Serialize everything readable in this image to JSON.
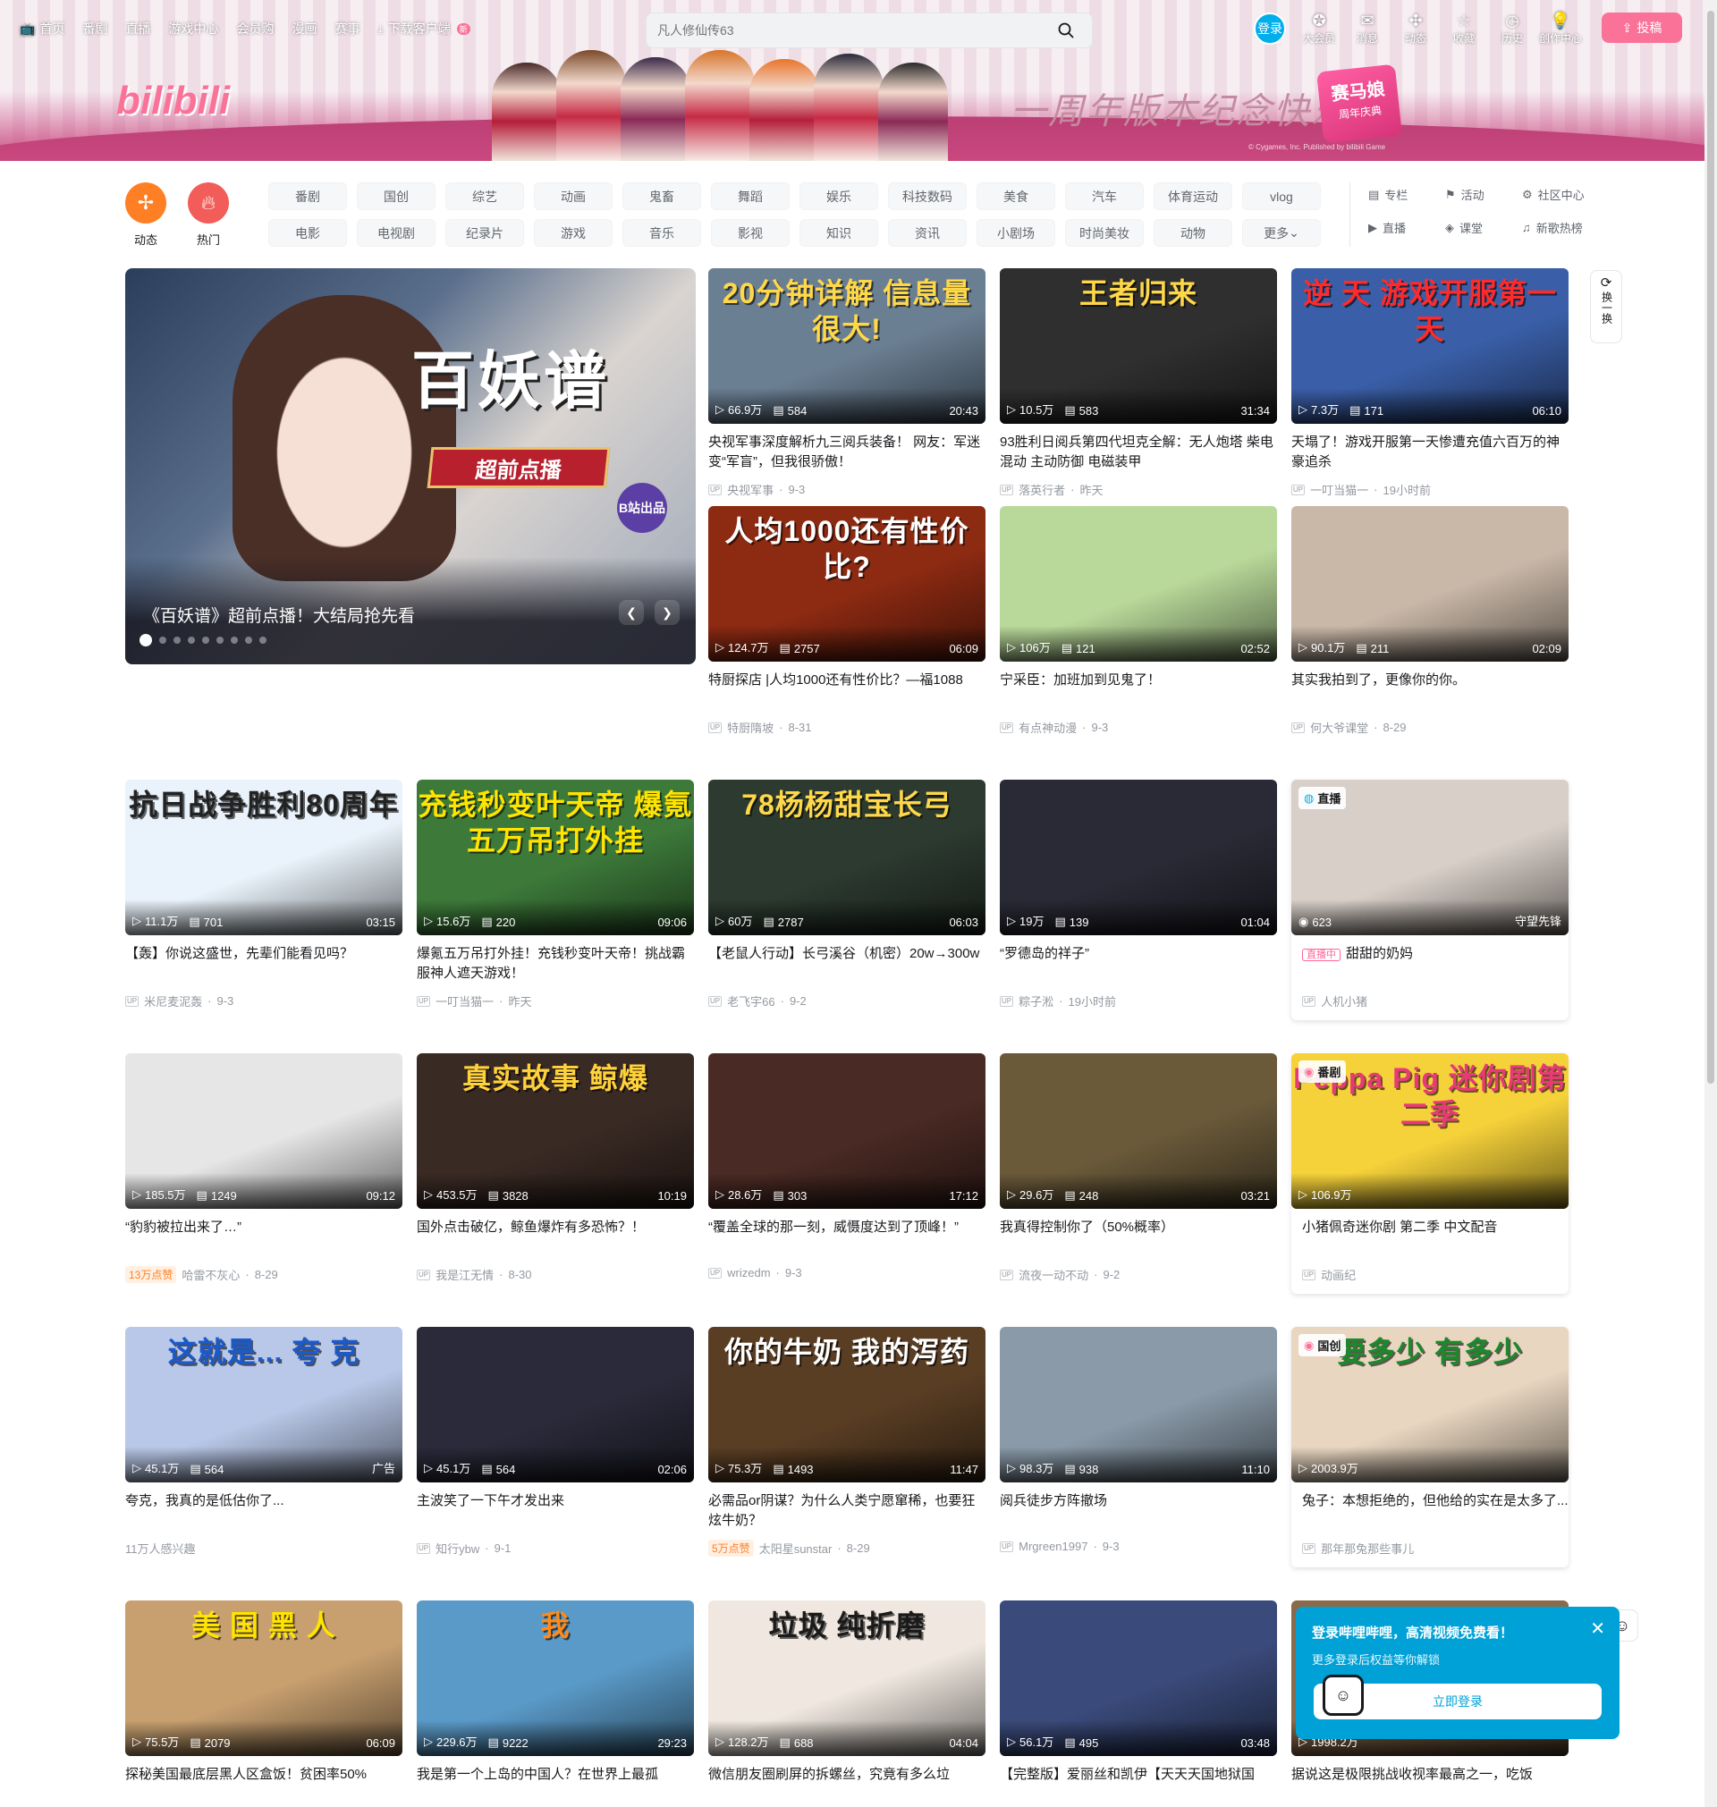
{
  "nav": {
    "items": [
      "首页",
      "番剧",
      "直播",
      "游戏中心",
      "会员购",
      "漫画",
      "赛事"
    ],
    "download": "下载客户端",
    "new_badge": "新"
  },
  "search": {
    "placeholder": "凡人修仙传63"
  },
  "login": "登录",
  "right_nav": [
    {
      "label": "大会员",
      "icon": "vip-icon"
    },
    {
      "label": "消息",
      "icon": "message-icon"
    },
    {
      "label": "动态",
      "icon": "dynamic-icon"
    },
    {
      "label": "收藏",
      "icon": "favorite-icon"
    },
    {
      "label": "历史",
      "icon": "history-icon"
    },
    {
      "label": "创作中心",
      "icon": "creator-icon"
    }
  ],
  "upload": "投稿",
  "banner": {
    "slogan": "一周年版本纪念快乐!",
    "logo": "bilibili",
    "game_badge": "赛马娘",
    "game_badge_sub": "周年庆典",
    "copyright": "© Cygames, Inc. Published by bilibili Game"
  },
  "channels": {
    "main": [
      {
        "label": "动态",
        "color": "#ff7f24",
        "icon": "wind-icon"
      },
      {
        "label": "热门",
        "color": "#f25d59",
        "icon": "fire-icon"
      }
    ],
    "chips": [
      "番剧",
      "国创",
      "综艺",
      "动画",
      "鬼畜",
      "舞蹈",
      "娱乐",
      "科技数码",
      "美食",
      "汽车",
      "体育运动",
      "vlog",
      "电影",
      "电视剧",
      "纪录片",
      "游戏",
      "音乐",
      "影视",
      "知识",
      "资讯",
      "小剧场",
      "时尚美妆",
      "动物",
      "更多"
    ],
    "side": [
      {
        "label": "专栏",
        "icon": "column-icon"
      },
      {
        "label": "活动",
        "icon": "activity-icon"
      },
      {
        "label": "社区中心",
        "icon": "community-icon"
      },
      {
        "label": "直播",
        "icon": "live-icon"
      },
      {
        "label": "课堂",
        "icon": "classroom-icon"
      },
      {
        "label": "新歌热榜",
        "icon": "music-chart-icon"
      }
    ]
  },
  "carousel": {
    "title": "《百妖谱》超前点播！大结局抢先看",
    "art_title": "百妖谱",
    "ribbon": "超前点播",
    "stamp": "B站出品",
    "dots": 9,
    "active_dot": 0
  },
  "refresh": {
    "label": "换一换"
  },
  "popup": {
    "title": "登录哔哩哔哩，高清视频免费看！",
    "subtitle": "更多登录后权益等你解锁",
    "button": "立即登录"
  },
  "cards": [
    {
      "art": "20分钟详解 信息量很大!",
      "views": "66.9万",
      "danmaku": "584",
      "duration": "20:43",
      "title": "央视军事深度解析九三阅兵装备！ 网友：军迷变“军盲”，但我很骄傲！",
      "author": "央视军事",
      "date": "9-3",
      "bg": "#6b7f93",
      "fg": "#ffd84a"
    },
    {
      "art": "王者归来",
      "views": "10.5万",
      "danmaku": "583",
      "duration": "31:34",
      "title": "93胜利日阅兵第四代坦克全解：无人炮塔 柴电混动 主动防御 电磁装甲",
      "author": "落英行者",
      "date": "昨天",
      "bg": "#2f2f2f",
      "fg": "#ffd84a"
    },
    {
      "art": "逆 天 游戏开服第一天",
      "views": "7.3万",
      "danmaku": "171",
      "duration": "06:10",
      "title": "天塌了！游戏开服第一天惨遭充值六百万的神豪追杀",
      "author": "一叮当猫一",
      "date": "19小时前",
      "bg": "#3a5fa8",
      "fg": "#ff2a2a"
    },
    {
      "art": "人均1000还有性价比?",
      "views": "124.7万",
      "danmaku": "2757",
      "duration": "06:09",
      "title": "特厨探店 |人均1000还有性价比？—福1088",
      "author": "特厨隋坡",
      "date": "8-31",
      "bg": "#8c2a12",
      "fg": "#ffffff"
    },
    {
      "art": "",
      "views": "106万",
      "danmaku": "121",
      "duration": "02:52",
      "title": "宁采臣：加班加到见鬼了！",
      "author": "有点神动漫",
      "date": "9-3",
      "bg": "#b9d99a",
      "fg": "#ffffff"
    },
    {
      "art": "",
      "views": "90.1万",
      "danmaku": "211",
      "duration": "02:09",
      "title": "其实我拍到了，更像你的你。",
      "author": "何大爷课堂",
      "date": "8-29",
      "bg": "#c9b8a8",
      "fg": "#ffffff"
    },
    {
      "art": "抗日战争胜利80周年",
      "views": "11.1万",
      "danmaku": "701",
      "duration": "03:15",
      "title": "【轰】你说这盛世，先辈们能看见吗？",
      "author": "米尼麦泥轰",
      "date": "9-3",
      "bg": "#eaf3fb",
      "fg": "#222222"
    },
    {
      "art": "充钱秒变叶天帝 爆氪五万吊打外挂",
      "views": "15.6万",
      "danmaku": "220",
      "duration": "09:06",
      "title": "爆氪五万吊打外挂！充钱秒变叶天帝！挑战霸服神人遮天游戏！",
      "author": "一叮当猫一",
      "date": "昨天",
      "bg": "#3d7a3a",
      "fg": "#ffe400"
    },
    {
      "art": "78杨杨甜宝长弓",
      "views": "60万",
      "danmaku": "2787",
      "duration": "06:03",
      "title": "【老鼠人行动】长弓溪谷（机密）20w→300w",
      "author": "老飞宇66",
      "date": "9-2",
      "bg": "#2c3a30",
      "fg": "#ffd84a"
    },
    {
      "art": "",
      "views": "19万",
      "danmaku": "139",
      "duration": "01:04",
      "title": "“罗德岛的祥子”",
      "author": "粽子淞",
      "date": "19小时前",
      "bg": "#2a2a36",
      "fg": "#ffffff"
    },
    {
      "art": "",
      "views": "623",
      "danmaku": "",
      "duration": "",
      "live_label": "直播",
      "streamer": "守望先锋",
      "title": "甜甜的奶妈",
      "live_badge": "直播中",
      "author": "人机小猪",
      "date": "",
      "bg": "#d8cfc8",
      "fg": "#ffffff"
    },
    {
      "art": "",
      "views": "185.5万",
      "danmaku": "1249",
      "duration": "09:12",
      "title": "“豹豹被拉出来了…”",
      "author": "哈雷不灰心",
      "date": "8-29",
      "hot": "13万点赞",
      "bg": "#e6e6e6",
      "fg": "#333333"
    },
    {
      "art": "真实故事 鲸爆",
      "views": "453.5万",
      "danmaku": "3828",
      "duration": "10:19",
      "title": "国外点击破亿，鲸鱼爆炸有多恐怖？！",
      "author": "我是江无情",
      "date": "8-30",
      "bg": "#3a2a24",
      "fg": "#ffd23a"
    },
    {
      "art": "",
      "views": "28.6万",
      "danmaku": "303",
      "duration": "17:12",
      "title": "“覆盖全球的那一刻，威慑度达到了顶峰！”",
      "author": "wrizedm",
      "date": "9-3",
      "bg": "#4a2a24",
      "fg": "#ffffff"
    },
    {
      "art": "",
      "views": "29.6万",
      "danmaku": "248",
      "duration": "03:21",
      "title": "我真得控制你了（50%概率）",
      "author": "流夜一动不动",
      "date": "9-2",
      "bg": "#6a5a3a",
      "fg": "#ffffff"
    },
    {
      "art": "Peppa Pig 迷你剧第二季",
      "views": "106.9万",
      "danmaku": "",
      "duration": "",
      "tag": "番剧",
      "title": "小猪佩奇迷你剧 第二季 中文配音",
      "author": "动画纪",
      "date": "",
      "bg": "#f6d23a",
      "fg": "#e83a78"
    },
    {
      "art": "这就是... 夸 克",
      "views": "45.1万",
      "danmaku": "564",
      "duration": "",
      "ad": "广告",
      "title": "夸克，我真的是低估你了...",
      "author": "11万人感兴趣",
      "date": "",
      "bg": "#b9c8e8",
      "fg": "#1a5acc"
    },
    {
      "art": "",
      "views": "45.1万",
      "danmaku": "564",
      "duration": "02:06",
      "title": "主波笑了一下午才发出来",
      "author": "知行ybw",
      "date": "9-1",
      "bg": "#2a2a3a",
      "fg": "#ffffff"
    },
    {
      "art": "你的牛奶 我的泻药",
      "views": "75.3万",
      "danmaku": "1493",
      "duration": "11:47",
      "title": "必需品or阴谋？为什么人类宁愿窜稀，也要狂炫牛奶？",
      "author": "太阳星sunstar",
      "date": "8-29",
      "hot": "5万点赞",
      "bg": "#5a3e24",
      "fg": "#ffffff"
    },
    {
      "art": "",
      "views": "98.3万",
      "danmaku": "938",
      "duration": "11:10",
      "title": "阅兵徒步方阵撤场",
      "author": "Mrgreen1997",
      "date": "9-3",
      "bg": "#8a9aa8",
      "fg": "#ffffff"
    },
    {
      "art": "要多少 有多少",
      "views": "2003.9万",
      "danmaku": "",
      "duration": "",
      "tag": "国创",
      "title": "兔子：本想拒绝的，但他给的实在是太多了...",
      "author": "那年那兔那些事儿",
      "date": "",
      "bg": "#e8d6c0",
      "fg": "#1a8a2a"
    },
    {
      "art": "美 国 黑 人",
      "views": "75.5万",
      "danmaku": "2079",
      "duration": "06:09",
      "title": "探秘美国最底层黑人区盒饭！贫困率50%",
      "author": "",
      "date": "",
      "bg": "#c8a070",
      "fg": "#ffe400"
    },
    {
      "art": "我",
      "views": "229.6万",
      "danmaku": "9222",
      "duration": "29:23",
      "title": "我是第一个上岛的中国人？在世界上最孤",
      "author": "",
      "date": "",
      "bg": "#5a9ac8",
      "fg": "#ff8a1a"
    },
    {
      "art": "垃圾 纯折磨",
      "views": "128.2万",
      "danmaku": "688",
      "duration": "04:04",
      "title": "微信朋友圈刷屏的拆螺丝，究竟有多么垃",
      "author": "",
      "date": "",
      "bg": "#f0e8e0",
      "fg": "#1a1a1a"
    },
    {
      "art": "",
      "views": "56.1万",
      "danmaku": "495",
      "duration": "03:48",
      "title": "【完整版】爱丽丝和凯伊【天天天国地狱国",
      "author": "",
      "date": "",
      "bg": "#3a4a7a",
      "fg": "#ffffff"
    },
    {
      "art": "",
      "views": "1998.2万",
      "danmaku": "",
      "duration": "",
      "title": "据说这是极限挑战收视率最高之一，吃饭",
      "author": "",
      "date": "",
      "bg": "#8a6a4a",
      "fg": "#ffffff"
    }
  ]
}
